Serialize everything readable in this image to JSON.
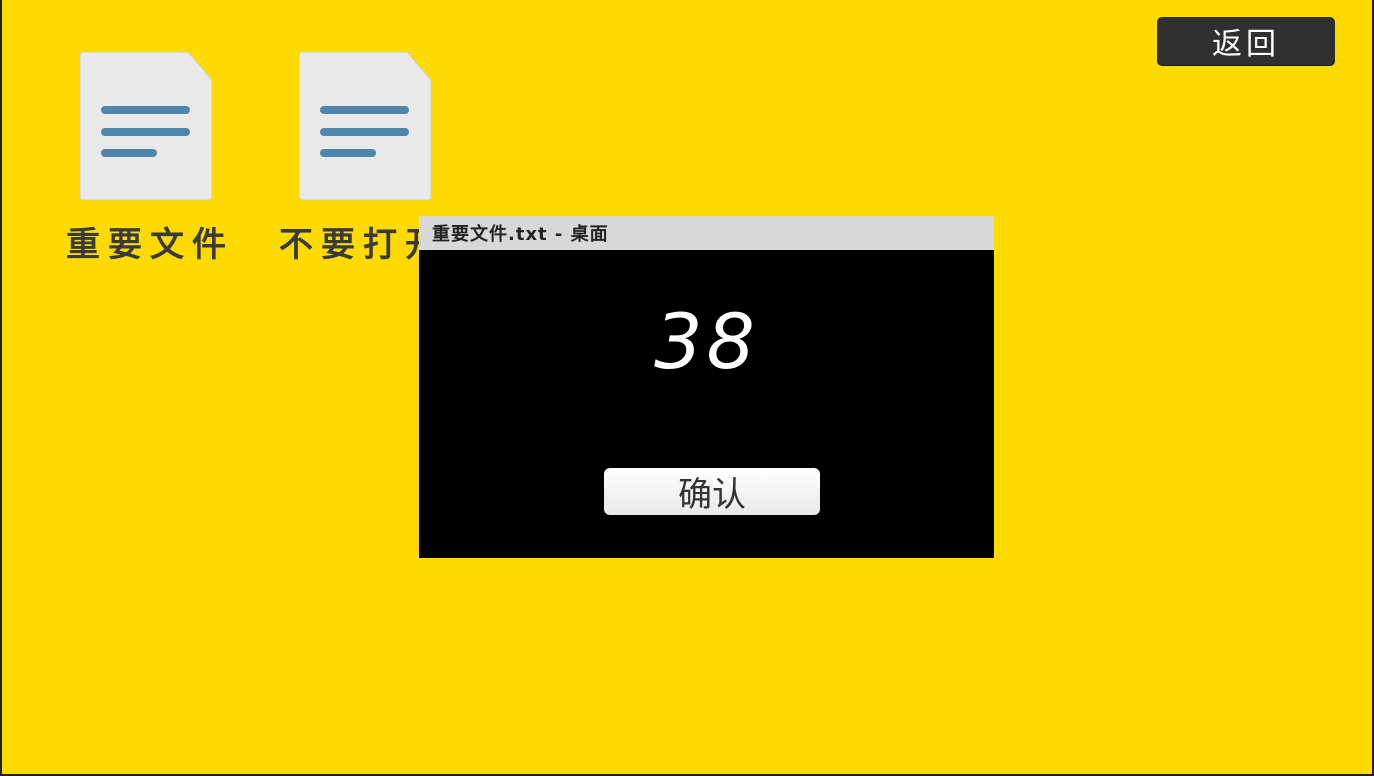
{
  "header": {
    "back_label": "返回"
  },
  "desktop_icons": [
    {
      "label": "重要文件",
      "icon": "text-file-icon"
    },
    {
      "label": "不要打开",
      "icon": "text-file-icon"
    }
  ],
  "dialog": {
    "title": "重要文件.txt - 桌面",
    "counter": "38",
    "confirm_label": "确认"
  },
  "colors": {
    "desktop_background": "#FEDB00",
    "file_icon_page": "#E9E9EA",
    "file_icon_lines": "#4E86AC",
    "back_button": "#303030",
    "dialog_background": "#000000",
    "titlebar": "#D8D8D8"
  }
}
